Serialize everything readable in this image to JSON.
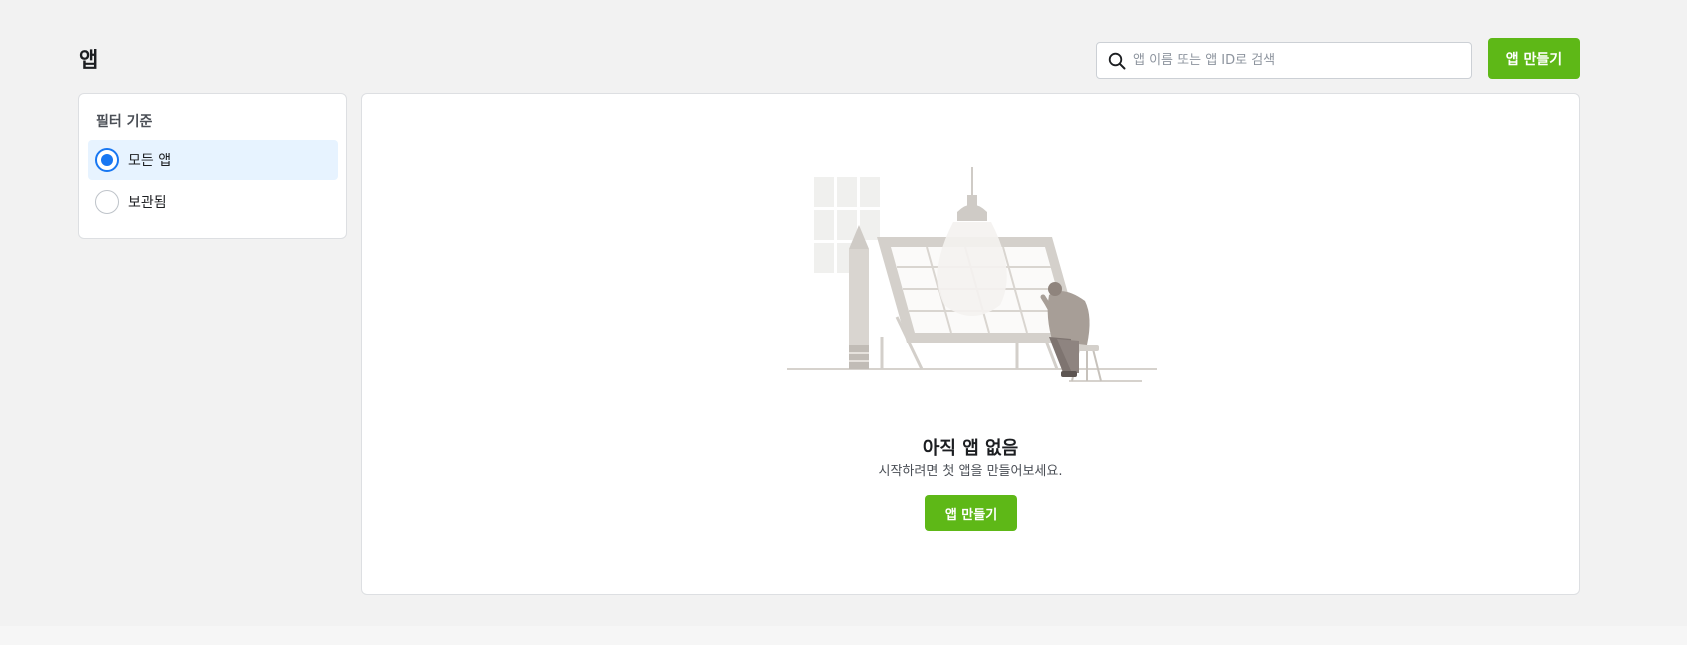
{
  "header": {
    "title": "앱",
    "search_placeholder": "앱 이름 또는 앱 ID로 검색",
    "create_button": "앱 만들기"
  },
  "filter": {
    "title": "필터 기준",
    "options": [
      {
        "label": "모든 앱",
        "selected": true
      },
      {
        "label": "보관됨",
        "selected": false
      }
    ]
  },
  "empty_state": {
    "title": "아직 앱 없음",
    "subtitle": "시작하려면 첫 앱을 만들어보세요.",
    "create_button": "앱 만들기"
  },
  "colors": {
    "accent_green": "#5eb817",
    "selected_bg": "#e7f3ff",
    "radio_blue": "#1877f2"
  },
  "icons": [
    "search-icon",
    "empty-state-illustration"
  ]
}
